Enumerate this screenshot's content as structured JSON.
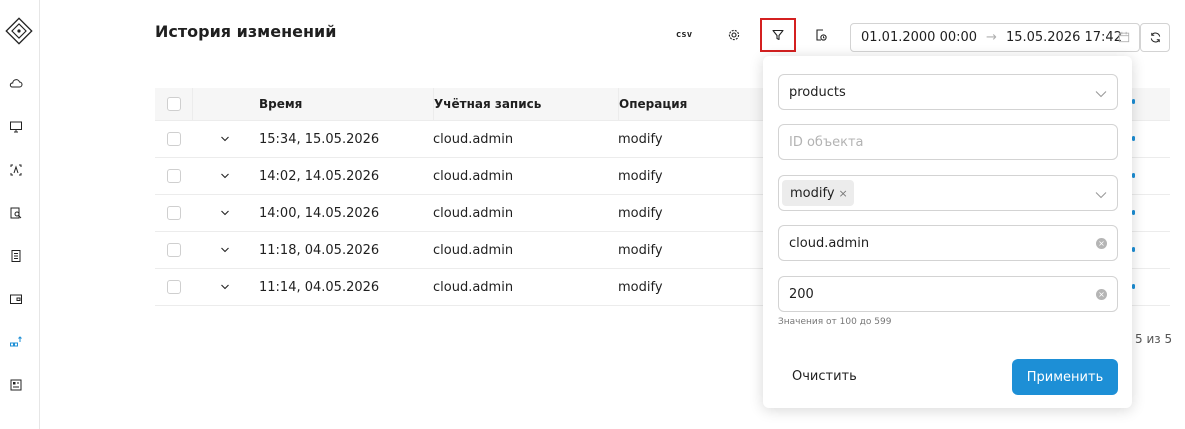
{
  "header": {
    "title": "История изменений",
    "csv_label": "csv",
    "date_from": "01.01.2000 00:00",
    "date_to": "15.05.2026 17:42",
    "arrow": "→"
  },
  "sidebar": {
    "icons": [
      "logo-diamond-icon",
      "cloud-icon",
      "monitor-icon",
      "scan-icon",
      "clipboard-search-icon",
      "document-list-icon",
      "wallet-icon",
      "network-icon",
      "grid-doc-icon"
    ],
    "active": "network-icon",
    "active_color": "#1d8fd6"
  },
  "table": {
    "columns": [
      "Время",
      "Учётная запись",
      "Операция"
    ],
    "rows": [
      {
        "time": "15:34, 15.05.2026",
        "account": "cloud.admin",
        "operation": "modify"
      },
      {
        "time": "14:02, 14.05.2026",
        "account": "cloud.admin",
        "operation": "modify"
      },
      {
        "time": "14:00, 14.05.2026",
        "account": "cloud.admin",
        "operation": "modify"
      },
      {
        "time": "11:18, 04.05.2026",
        "account": "cloud.admin",
        "operation": "modify"
      },
      {
        "time": "11:14, 04.05.2026",
        "account": "cloud.admin",
        "operation": "modify"
      }
    ],
    "pagination": "5 из 5"
  },
  "filter": {
    "entity_type": "products",
    "object_id_placeholder": "ID объекта",
    "operation_tag": "modify",
    "tag_remove": "×",
    "clear_glyph": "×",
    "account": "cloud.admin",
    "status_code": "200",
    "status_hint": "Значения от 100 до 599",
    "clear_label": "Очистить",
    "apply_label": "Применить",
    "apply_color": "#1d8fd6"
  }
}
